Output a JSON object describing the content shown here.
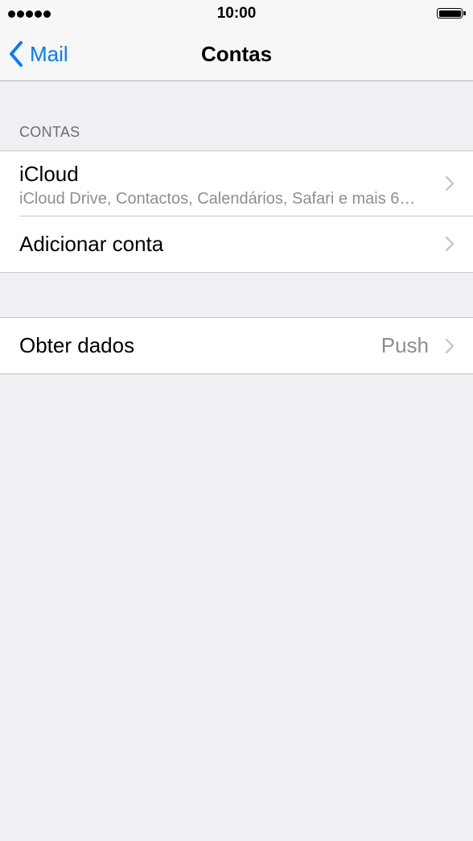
{
  "status_bar": {
    "signal_icon": "signal-dots-icon",
    "time": "10:00",
    "battery_icon": "battery-full-icon"
  },
  "nav": {
    "back_icon": "chevron-left-icon",
    "back_label": "Mail",
    "title": "Contas"
  },
  "accounts_section": {
    "header": "CONTAS",
    "items": [
      {
        "title": "iCloud",
        "subtitle": "iCloud Drive, Contactos, Calendários, Safari e mais 6…"
      },
      {
        "title": "Adicionar conta"
      }
    ]
  },
  "fetch_section": {
    "title": "Obter dados",
    "value": "Push"
  },
  "colors": {
    "accent": "#0a7aff",
    "background": "#efeff4",
    "secondary_text": "#8e8e93",
    "header_text": "#6d6d72",
    "separator": "#c8c7cc",
    "chevron": "#c7c7cc"
  }
}
